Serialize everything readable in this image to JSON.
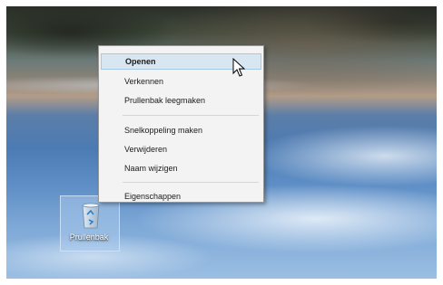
{
  "desktop": {
    "recycle_bin": {
      "label": "Prullenbak",
      "icon": "recycle-bin-icon"
    }
  },
  "context_menu": {
    "items": [
      {
        "label": "Openen",
        "bold": true,
        "highlighted": true
      },
      {
        "label": "Verkennen"
      },
      {
        "label": "Prullenbak leegmaken"
      },
      {
        "separator": true
      },
      {
        "label": "Snelkoppeling maken"
      },
      {
        "label": "Verwijderen"
      },
      {
        "label": "Naam wijzigen"
      },
      {
        "separator": true
      },
      {
        "label": "Eigenschappen"
      }
    ]
  },
  "colors": {
    "menu_background": "#f3f3f3",
    "menu_highlight": "#d8e6f2",
    "menu_border": "#979797"
  }
}
